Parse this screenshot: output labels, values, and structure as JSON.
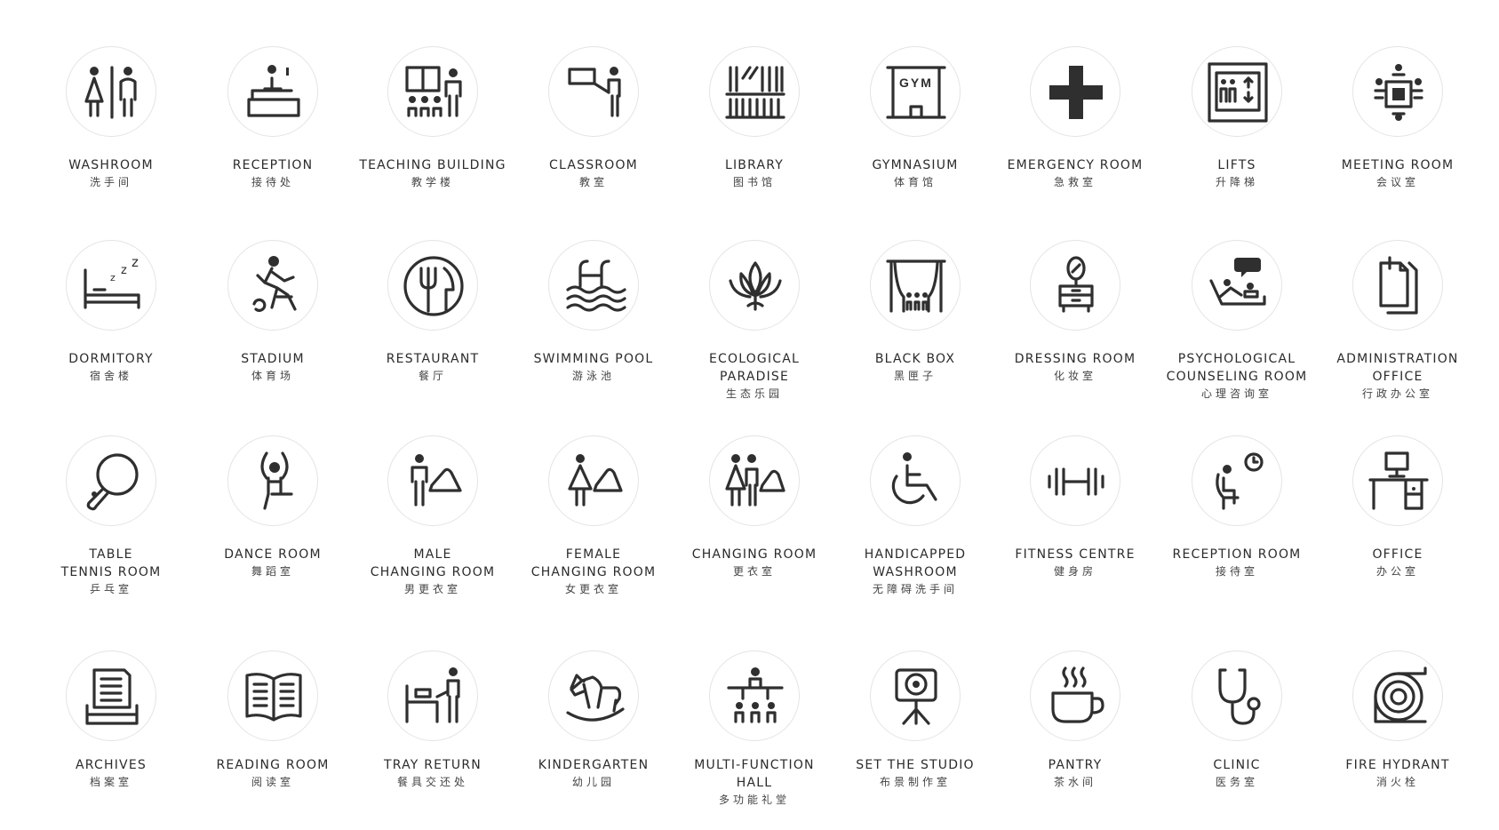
{
  "signs": [
    {
      "icon": "washroom-icon",
      "en": [
        "WASHROOM"
      ],
      "zh": "洗手间"
    },
    {
      "icon": "reception-icon",
      "en": [
        "RECEPTION"
      ],
      "zh": "接待处"
    },
    {
      "icon": "teaching-building-icon",
      "en": [
        "TEACHING BUILDING"
      ],
      "zh": "教学楼"
    },
    {
      "icon": "classroom-icon",
      "en": [
        "CLASSROOM"
      ],
      "zh": "教室"
    },
    {
      "icon": "library-icon",
      "en": [
        "LIBRARY"
      ],
      "zh": "图书馆"
    },
    {
      "icon": "gymnasium-icon",
      "en": [
        "GYMNASIUM"
      ],
      "zh": "体育馆",
      "icon_text": "GYM"
    },
    {
      "icon": "emergency-cross-icon",
      "en": [
        "EMERGENCY ROOM"
      ],
      "zh": "急救室"
    },
    {
      "icon": "lifts-icon",
      "en": [
        "LIFTS"
      ],
      "zh": "升降梯"
    },
    {
      "icon": "meeting-room-icon",
      "en": [
        "MEETING ROOM"
      ],
      "zh": "会议室"
    },
    {
      "icon": "dormitory-bed-icon",
      "en": [
        "DORMITORY"
      ],
      "zh": "宿舍楼"
    },
    {
      "icon": "stadium-runner-icon",
      "en": [
        "STADIUM"
      ],
      "zh": "体育场"
    },
    {
      "icon": "restaurant-fork-knife-icon",
      "en": [
        "RESTAURANT"
      ],
      "zh": "餐厅"
    },
    {
      "icon": "swimming-pool-icon",
      "en": [
        "SWIMMING POOL"
      ],
      "zh": "游泳池"
    },
    {
      "icon": "lotus-leaf-icon",
      "en": [
        "ECOLOGICAL PARADISE"
      ],
      "zh": "生态乐园"
    },
    {
      "icon": "stage-curtain-icon",
      "en": [
        "BLACK BOX"
      ],
      "zh": "黑匣子"
    },
    {
      "icon": "dressing-table-icon",
      "en": [
        "DRESSING ROOM"
      ],
      "zh": "化妆室"
    },
    {
      "icon": "counseling-couch-icon",
      "en": [
        "PSYCHOLOGICAL",
        "COUNSELING ROOM"
      ],
      "zh": "心理咨询室"
    },
    {
      "icon": "documents-icon",
      "en": [
        "ADMINISTRATION",
        "OFFICE"
      ],
      "zh": "行政办公室"
    },
    {
      "icon": "ping-pong-paddle-icon",
      "en": [
        "TABLE",
        "TENNIS ROOM"
      ],
      "zh": "乒乓室"
    },
    {
      "icon": "dancer-icon",
      "en": [
        "DANCE ROOM"
      ],
      "zh": "舞蹈室"
    },
    {
      "icon": "male-changing-icon",
      "en": [
        "MALE",
        "CHANGING ROOM"
      ],
      "zh": "男更衣室"
    },
    {
      "icon": "female-changing-icon",
      "en": [
        "FEMALE",
        "CHANGING ROOM"
      ],
      "zh": "女更衣室"
    },
    {
      "icon": "changing-room-icon",
      "en": [
        "CHANGING ROOM"
      ],
      "zh": "更衣室"
    },
    {
      "icon": "wheelchair-icon",
      "en": [
        "HANDICAPPED",
        "WASHROOM"
      ],
      "zh": "无障碍洗手间"
    },
    {
      "icon": "dumbbell-icon",
      "en": [
        "FITNESS CENTRE"
      ],
      "zh": "健身房"
    },
    {
      "icon": "waiting-clock-icon",
      "en": [
        "RECEPTION ROOM"
      ],
      "zh": "接待室"
    },
    {
      "icon": "office-desk-icon",
      "en": [
        "OFFICE"
      ],
      "zh": "办公室"
    },
    {
      "icon": "archive-tray-icon",
      "en": [
        "ARCHIVES"
      ],
      "zh": "档案室"
    },
    {
      "icon": "open-book-icon",
      "en": [
        "READING ROOM"
      ],
      "zh": "阅读室"
    },
    {
      "icon": "tray-return-icon",
      "en": [
        "TRAY RETURN"
      ],
      "zh": "餐具交还处"
    },
    {
      "icon": "rocking-horse-icon",
      "en": [
        "KINDERGARTEN"
      ],
      "zh": "幼儿园"
    },
    {
      "icon": "podium-audience-icon",
      "en": [
        "MULTI-FUNCTION HALL"
      ],
      "zh": "多功能礼堂"
    },
    {
      "icon": "camera-tripod-icon",
      "en": [
        "SET THE STUDIO"
      ],
      "zh": "布景制作室"
    },
    {
      "icon": "coffee-cup-icon",
      "en": [
        "PANTRY"
      ],
      "zh": "茶水间"
    },
    {
      "icon": "stethoscope-icon",
      "en": [
        "CLINIC"
      ],
      "zh": "医务室"
    },
    {
      "icon": "fire-hose-reel-icon",
      "en": [
        "FIRE HYDRANT"
      ],
      "zh": "消火栓"
    }
  ]
}
